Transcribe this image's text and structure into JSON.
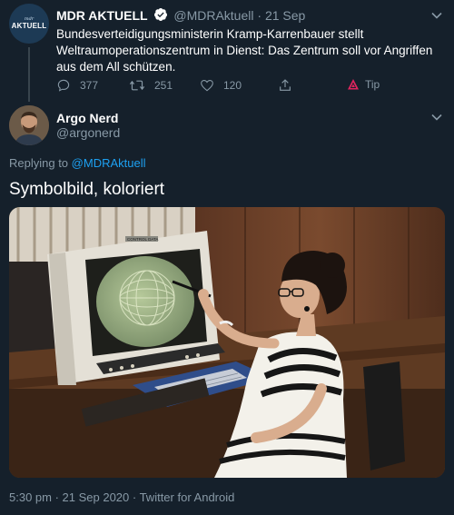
{
  "parent_tweet": {
    "avatar_text_top": "mdr",
    "avatar_text_bottom": "AKTUELL",
    "display_name": "MDR AKTUELL",
    "handle": "@MDRAktuell",
    "separator": "·",
    "date": "21 Sep",
    "text": "Bundesverteidigungsministerin Kramp-Karrenbauer stellt Weltraumoperationszentrum in Dienst: Das Zentrum soll vor Angriffen aus dem All schützen.",
    "actions": {
      "replies": "377",
      "retweets": "251",
      "likes": "120",
      "tip": "Tip"
    }
  },
  "reply_tweet": {
    "display_name": "Argo Nerd",
    "handle": "@argonerd",
    "replying_prefix": "Replying to",
    "replying_to": "@MDRAktuell",
    "text": "Symbolbild, koloriert",
    "monitor_label": "CONTROL DATA"
  },
  "meta": {
    "timestamp": "5:30 pm · 21 Sep 2020 · Twitter for Android"
  },
  "colors": {
    "background": "#15202b",
    "text": "#ffffff",
    "secondary": "#8899a6",
    "link": "#1da1f2",
    "tip_red": "#e0245e"
  },
  "icons": [
    "verified-badge-icon",
    "chevron-down-icon",
    "reply-icon",
    "retweet-icon",
    "like-icon",
    "share-icon",
    "tip-icon"
  ]
}
